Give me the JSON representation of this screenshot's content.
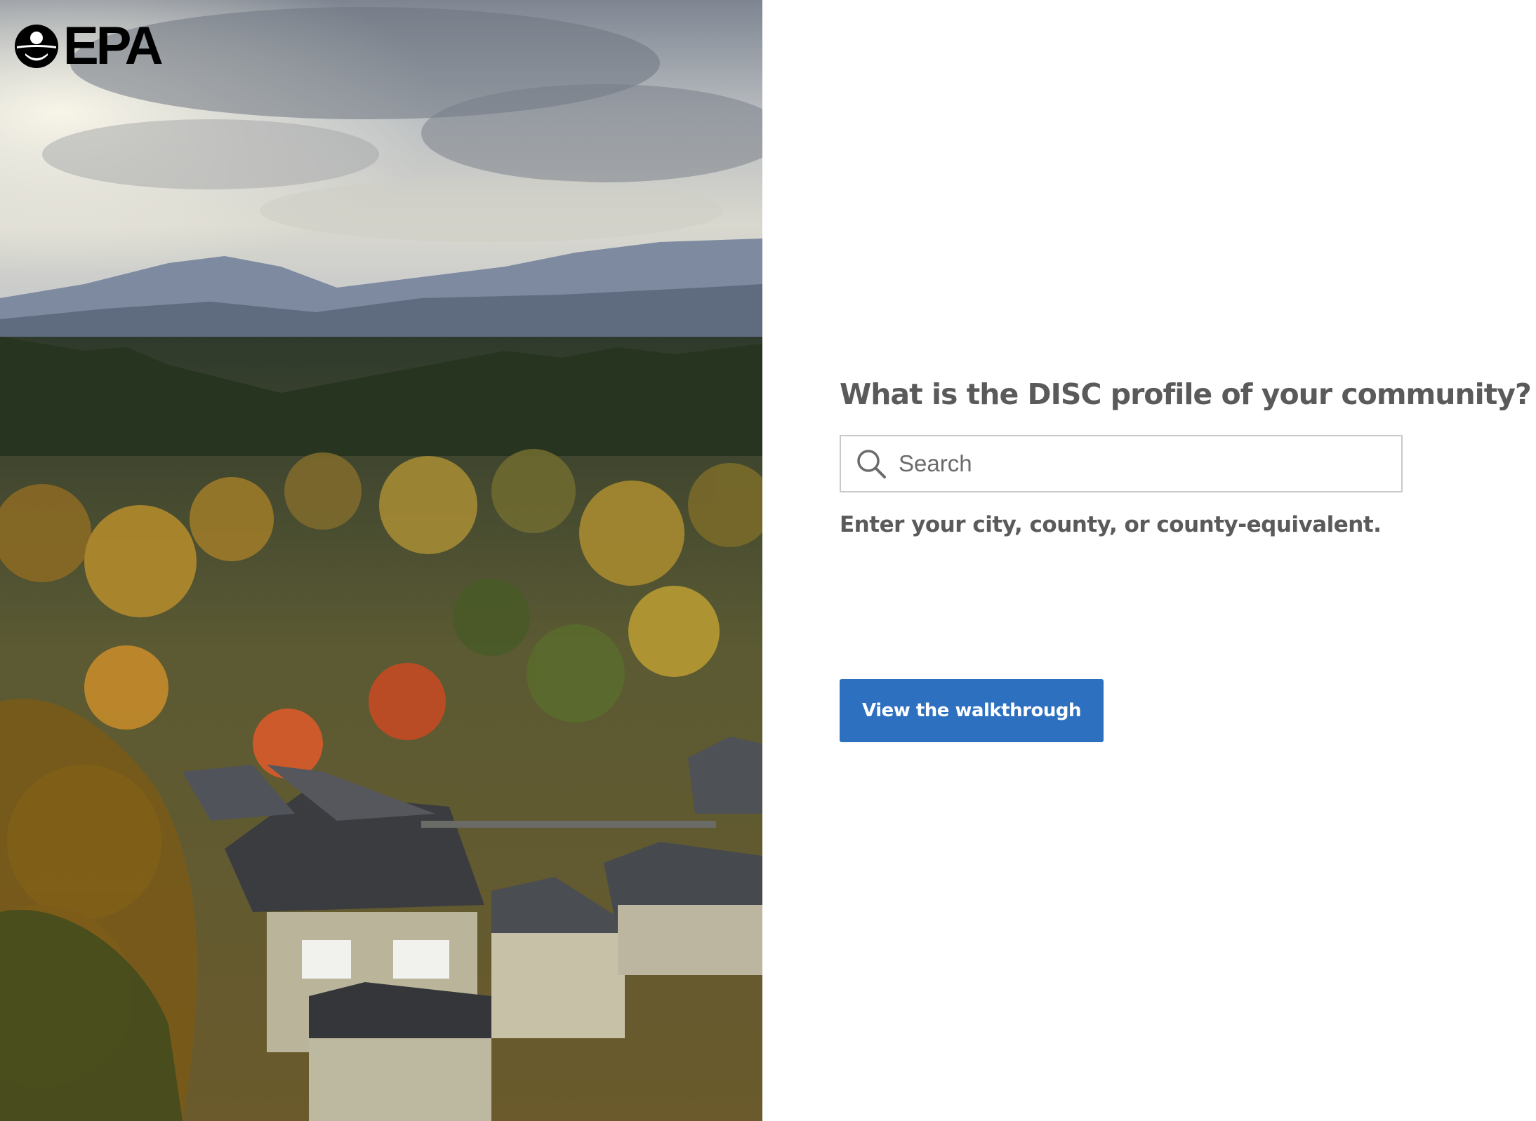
{
  "logo": {
    "wordmark": "EPA"
  },
  "main": {
    "question": "What is the DISC profile of your community?",
    "search": {
      "placeholder": "Search",
      "value": ""
    },
    "hint": "Enter your city, county, or county-equivalent.",
    "walkthrough_label": "View the walkthrough"
  },
  "colors": {
    "button_bg": "#2e70c0",
    "heading_text": "#5a5a5a",
    "input_border": "#c9c9c9"
  },
  "icons": {
    "search": "search-icon",
    "logo": "epa-seal-icon"
  }
}
